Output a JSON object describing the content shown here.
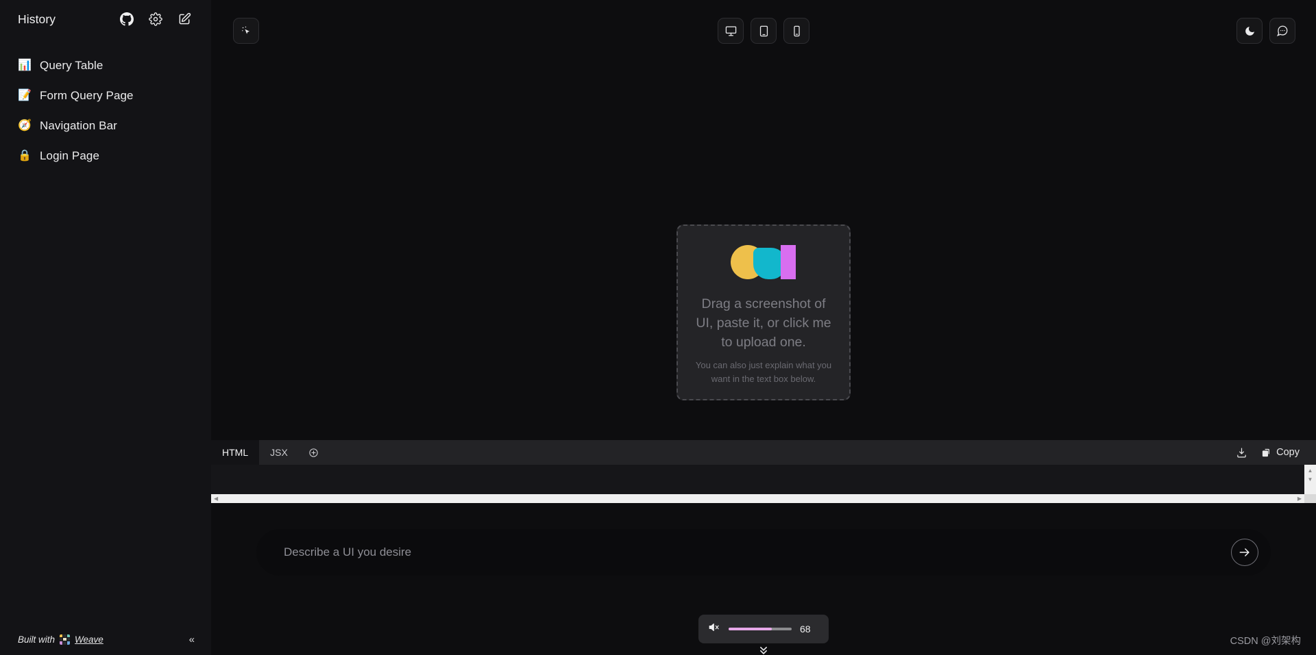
{
  "sidebar": {
    "title": "History",
    "head_icons": [
      {
        "name": "github-icon"
      },
      {
        "name": "gear-icon"
      },
      {
        "name": "new-chat-icon"
      }
    ],
    "items": [
      {
        "emoji": "📊",
        "label": "Query Table",
        "icon_name": "bar-chart-emoji"
      },
      {
        "emoji": "📝",
        "label": "Form Query Page",
        "icon_name": "memo-emoji"
      },
      {
        "emoji": "🧭",
        "label": "Navigation Bar",
        "icon_name": "compass-emoji"
      },
      {
        "emoji": "🔒",
        "label": "Login Page",
        "icon_name": "lock-emoji"
      }
    ],
    "footer": {
      "built_with": "Built with",
      "brand": "Weave",
      "collapse": "«"
    }
  },
  "topbar": {
    "select_tool": "pointer-select",
    "devices": [
      {
        "name": "desktop-view",
        "label": "Desktop"
      },
      {
        "name": "tablet-view",
        "label": "Tablet"
      },
      {
        "name": "mobile-view",
        "label": "Mobile"
      }
    ],
    "theme_toggle": "Dark mode",
    "chat_toggle": "Chat"
  },
  "dropzone": {
    "primary_text": "Drag a screenshot of UI, paste it, or click me to upload one.",
    "secondary_text": "You can also just explain what you want in the text box below.",
    "logo_colors": {
      "circle": "#eec04b",
      "leaf": "#12b7cc",
      "rect": "#d86ef0"
    }
  },
  "code_panel": {
    "tabs": [
      {
        "label": "HTML",
        "active": true
      },
      {
        "label": "JSX",
        "active": false
      }
    ],
    "add_tab": "+",
    "download_label": "Download",
    "copy_label": "Copy",
    "code_content": ""
  },
  "prompt": {
    "placeholder": "Describe a UI you desire",
    "value": "",
    "send_label": "Send"
  },
  "volume_overlay": {
    "icon": "speaker-muted",
    "value": "68",
    "percent": 68,
    "fill_color": "#e6a8e8"
  },
  "watermark": "CSDN @刘架构"
}
